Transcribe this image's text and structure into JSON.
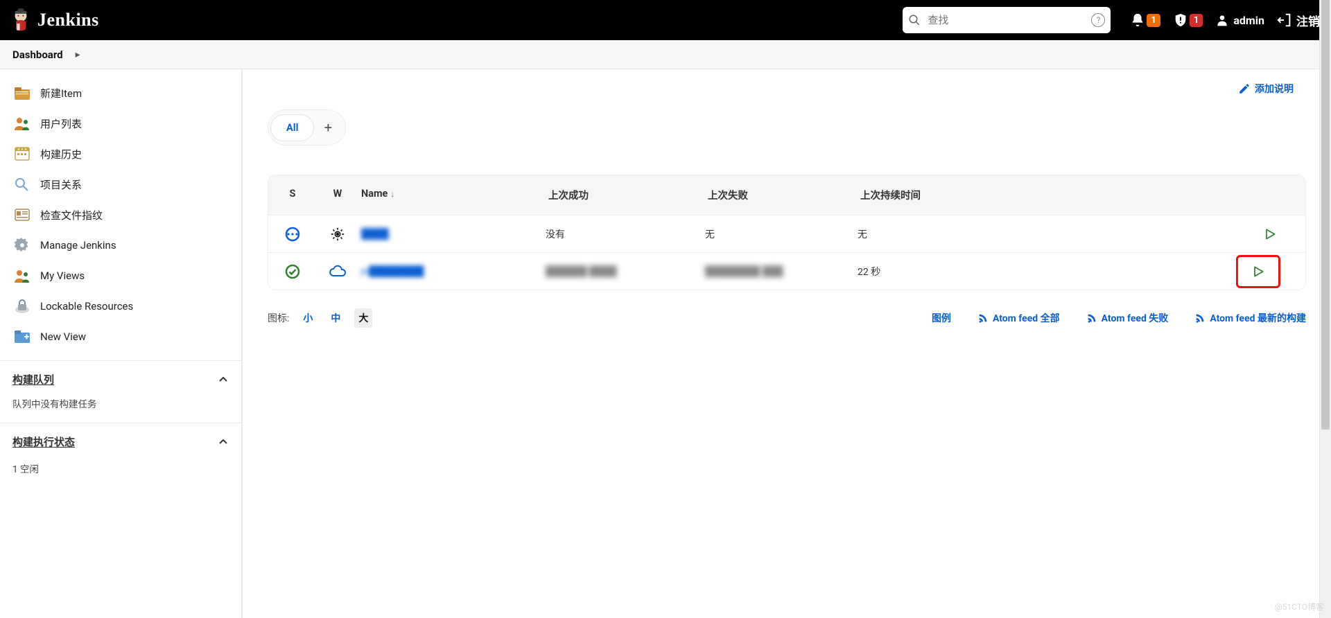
{
  "header": {
    "brand": "Jenkins",
    "search_placeholder": "查找",
    "notif_badge": "1",
    "security_badge": "1",
    "username": "admin",
    "logout": "注销"
  },
  "breadcrumb": {
    "root": "Dashboard"
  },
  "sidebar": {
    "items": [
      {
        "label": "新建Item"
      },
      {
        "label": "用户列表"
      },
      {
        "label": "构建历史"
      },
      {
        "label": "项目关系"
      },
      {
        "label": "检查文件指纹"
      },
      {
        "label": "Manage Jenkins"
      },
      {
        "label": "My Views"
      },
      {
        "label": "Lockable Resources"
      },
      {
        "label": "New View"
      }
    ],
    "queue": {
      "title": "构建队列",
      "empty": "队列中没有构建任务"
    },
    "exec": {
      "title": "构建执行状态",
      "rows": [
        "1  空闲"
      ]
    }
  },
  "main": {
    "add_description": "添加说明",
    "tabs": {
      "all": "All"
    },
    "columns": {
      "s": "S",
      "w": "W",
      "name": "Name",
      "succ": "上次成功",
      "fail": "上次失败",
      "dur": "上次持续时间"
    },
    "rows": [
      {
        "status": "building",
        "weather": "sun-target",
        "name": "████",
        "succ": "没有",
        "fail": "无",
        "dur": "无"
      },
      {
        "status": "success",
        "weather": "cloud",
        "name": "jn████████",
        "succ": "██████  ████",
        "fail": "████████  ███",
        "dur": "22 秒"
      }
    ],
    "footer": {
      "icon_label": "图标:",
      "sizes": [
        "小",
        "中",
        "大"
      ],
      "legend": "图例",
      "feeds": [
        "Atom feed 全部",
        "Atom feed 失败",
        "Atom feed 最新的构建"
      ]
    }
  },
  "watermark": "@51CTO博客"
}
